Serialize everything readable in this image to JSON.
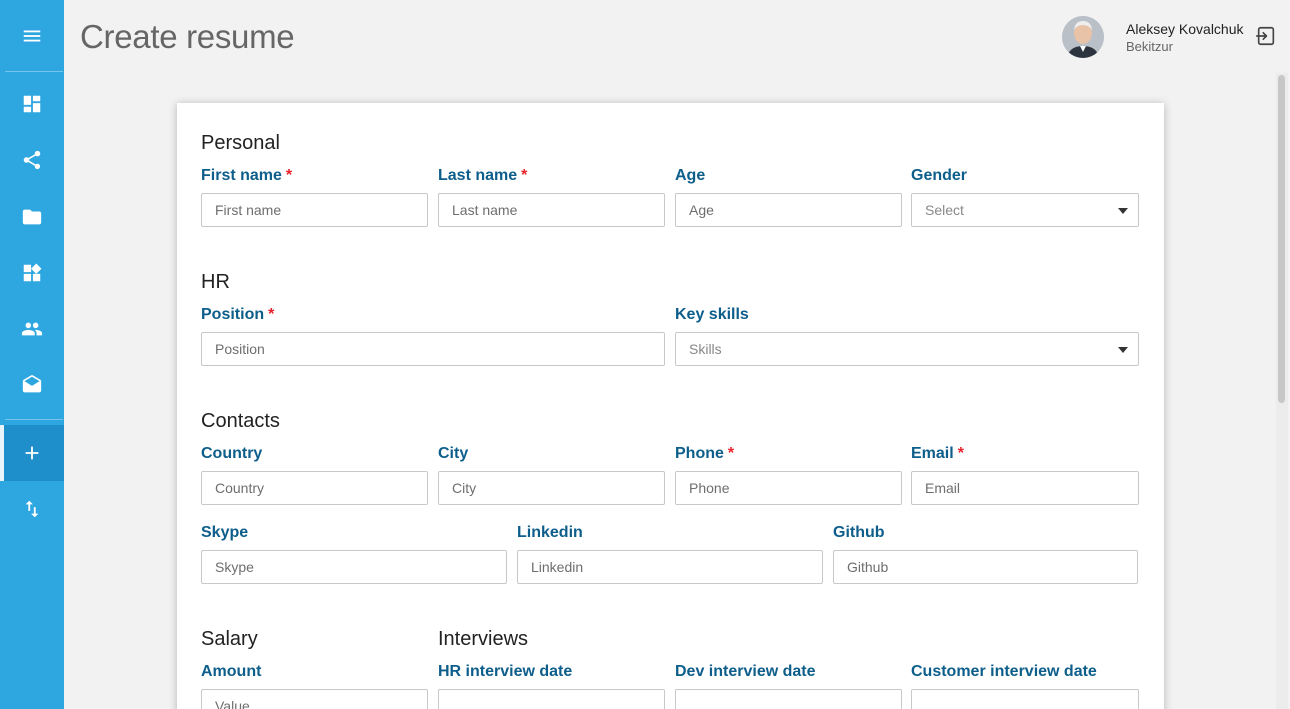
{
  "page": {
    "title": "Create resume"
  },
  "user": {
    "name": "Aleksey Kovalchuk",
    "org": "Bekitzur"
  },
  "sidebar": {
    "items": [
      {
        "name": "menu-icon"
      },
      {
        "name": "dashboard-icon"
      },
      {
        "name": "share-icon"
      },
      {
        "name": "folder-icon"
      },
      {
        "name": "widgets-icon"
      },
      {
        "name": "people-icon"
      },
      {
        "name": "mail-icon"
      },
      {
        "name": "add-icon",
        "active": true
      },
      {
        "name": "import-export-icon"
      }
    ]
  },
  "form": {
    "personal": {
      "title": "Personal",
      "first_name": {
        "label": "First name",
        "placeholder": "First name",
        "required": "*"
      },
      "last_name": {
        "label": "Last name",
        "placeholder": "Last name",
        "required": "*"
      },
      "age": {
        "label": "Age",
        "placeholder": "Age"
      },
      "gender": {
        "label": "Gender",
        "placeholder": "Select"
      }
    },
    "hr": {
      "title": "HR",
      "position": {
        "label": "Position",
        "placeholder": "Position",
        "required": "*"
      },
      "key_skills": {
        "label": "Key skills",
        "placeholder": "Skills"
      }
    },
    "contacts": {
      "title": "Contacts",
      "country": {
        "label": "Country",
        "placeholder": "Country"
      },
      "city": {
        "label": "City",
        "placeholder": "City"
      },
      "phone": {
        "label": "Phone",
        "placeholder": "Phone",
        "required": "*"
      },
      "email": {
        "label": "Email",
        "placeholder": "Email",
        "required": "*"
      },
      "skype": {
        "label": "Skype",
        "placeholder": "Skype"
      },
      "linkedin": {
        "label": "Linkedin",
        "placeholder": "Linkedin"
      },
      "github": {
        "label": "Github",
        "placeholder": "Github"
      }
    },
    "salary": {
      "title": "Salary",
      "amount": {
        "label": "Amount",
        "placeholder": "Value"
      }
    },
    "interviews": {
      "title": "Interviews",
      "hr_date": {
        "label": "HR interview date",
        "placeholder": ""
      },
      "dev_date": {
        "label": "Dev interview date",
        "placeholder": ""
      },
      "customer_date": {
        "label": "Customer interview date",
        "placeholder": ""
      }
    }
  },
  "colors": {
    "sidebar": "#2ea6e0",
    "label": "#0d5e8b",
    "required": "#e8222a"
  }
}
